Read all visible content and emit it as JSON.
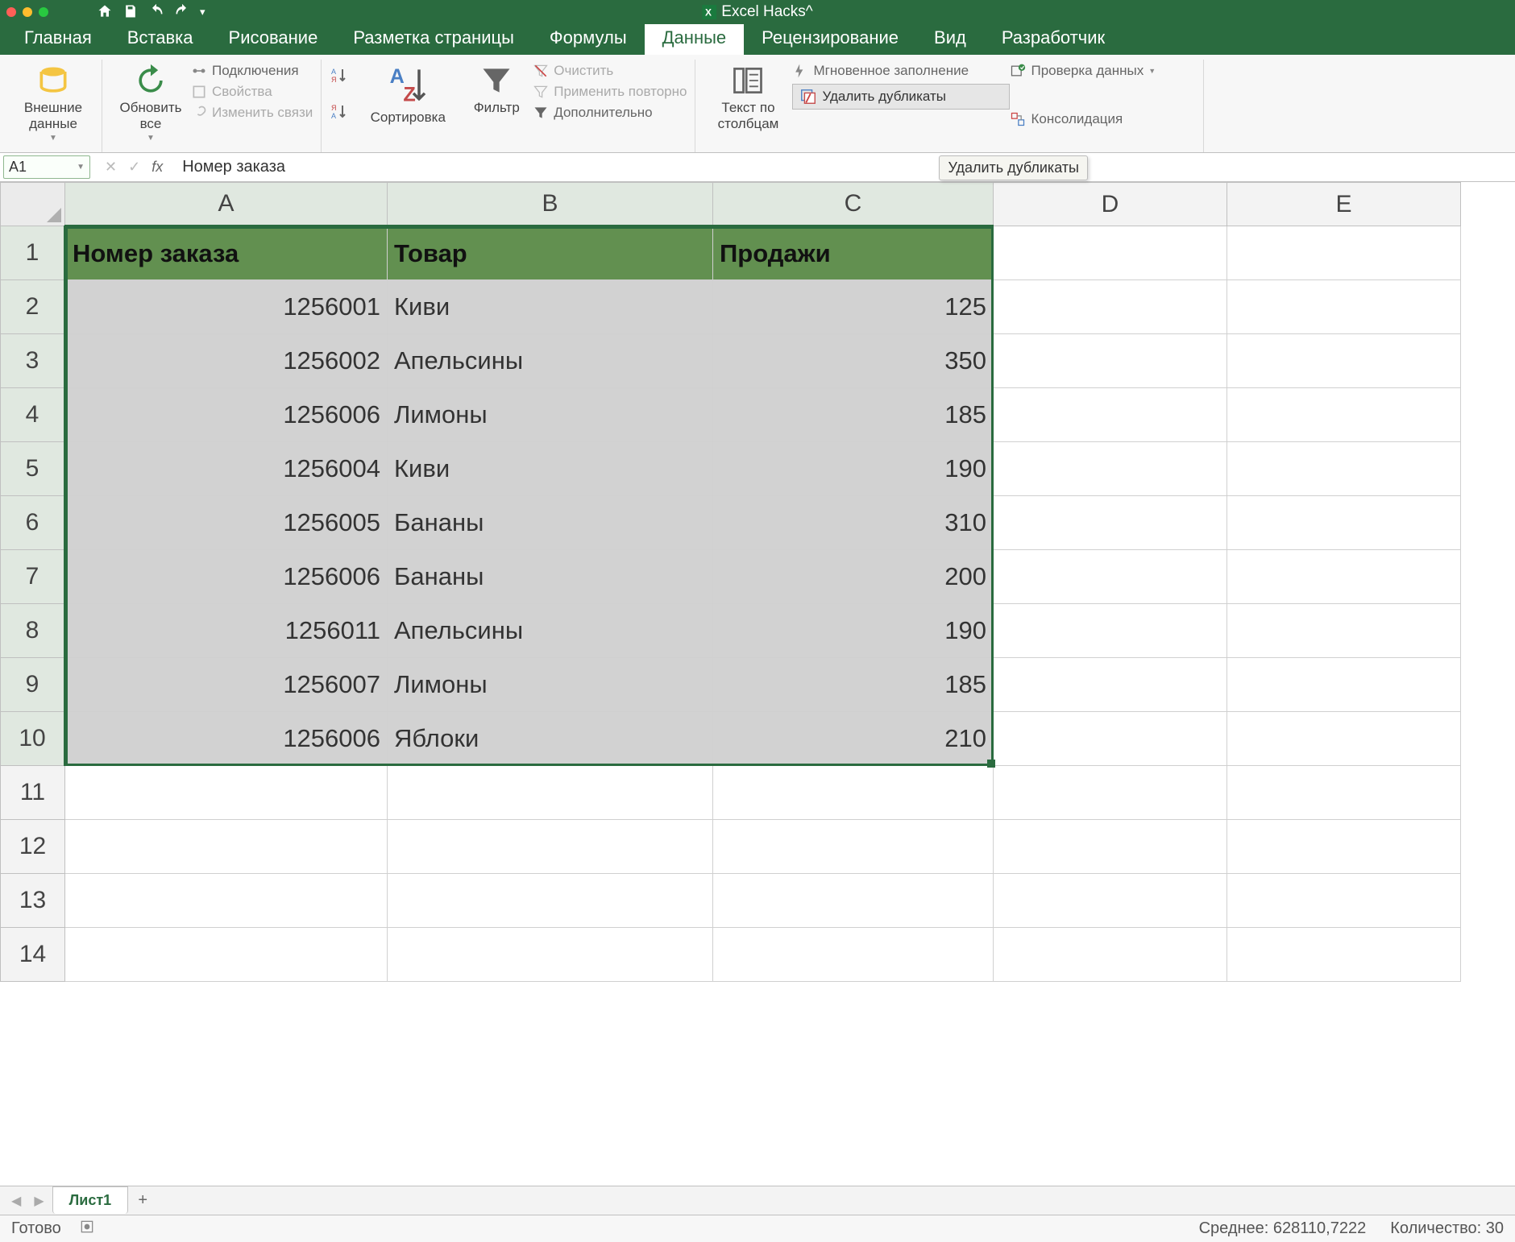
{
  "titlebar": {
    "document_name": "Excel Hacks^"
  },
  "ribbon_tabs": [
    "Главная",
    "Вставка",
    "Рисование",
    "Разметка страницы",
    "Формулы",
    "Данные",
    "Рецензирование",
    "Вид",
    "Разработчик"
  ],
  "active_tab": "Данные",
  "ribbon": {
    "external_data": "Внешние\nданные",
    "refresh_all": "Обновить\nвсе",
    "connections": "Подключения",
    "properties": "Свойства",
    "edit_links": "Изменить связи",
    "sort": "Сортировка",
    "filter": "Фильтр",
    "clear": "Очистить",
    "reapply": "Применить повторно",
    "advanced": "Дополнительно",
    "text_to_columns": "Текст по\nстолбцам",
    "flash_fill": "Мгновенное заполнение",
    "remove_duplicates": "Удалить дубликаты",
    "data_validation": "Проверка данных",
    "consolidate": "Консолидация"
  },
  "tooltip": "Удалить дубликаты",
  "name_box": "A1",
  "formula": "Номер заказа",
  "columns": [
    "A",
    "B",
    "C",
    "D",
    "E"
  ],
  "row_max": 14,
  "table": {
    "headers": [
      "Номер заказа",
      "Товар",
      "Продажи"
    ],
    "rows": [
      {
        "order": 1256001,
        "product": "Киви",
        "sales": 125
      },
      {
        "order": 1256002,
        "product": "Апельсины",
        "sales": 350
      },
      {
        "order": 1256006,
        "product": "Лимоны",
        "sales": 185
      },
      {
        "order": 1256004,
        "product": "Киви",
        "sales": 190
      },
      {
        "order": 1256005,
        "product": "Бананы",
        "sales": 310
      },
      {
        "order": 1256006,
        "product": "Бананы",
        "sales": 200
      },
      {
        "order": 1256011,
        "product": "Апельсины",
        "sales": 190
      },
      {
        "order": 1256007,
        "product": "Лимоны",
        "sales": 185
      },
      {
        "order": 1256006,
        "product": "Яблоки",
        "sales": 210
      }
    ]
  },
  "sheet_tab": "Лист1",
  "statusbar": {
    "ready": "Готово",
    "average": "Среднее: 628110,7222",
    "count": "Количество: 30"
  }
}
